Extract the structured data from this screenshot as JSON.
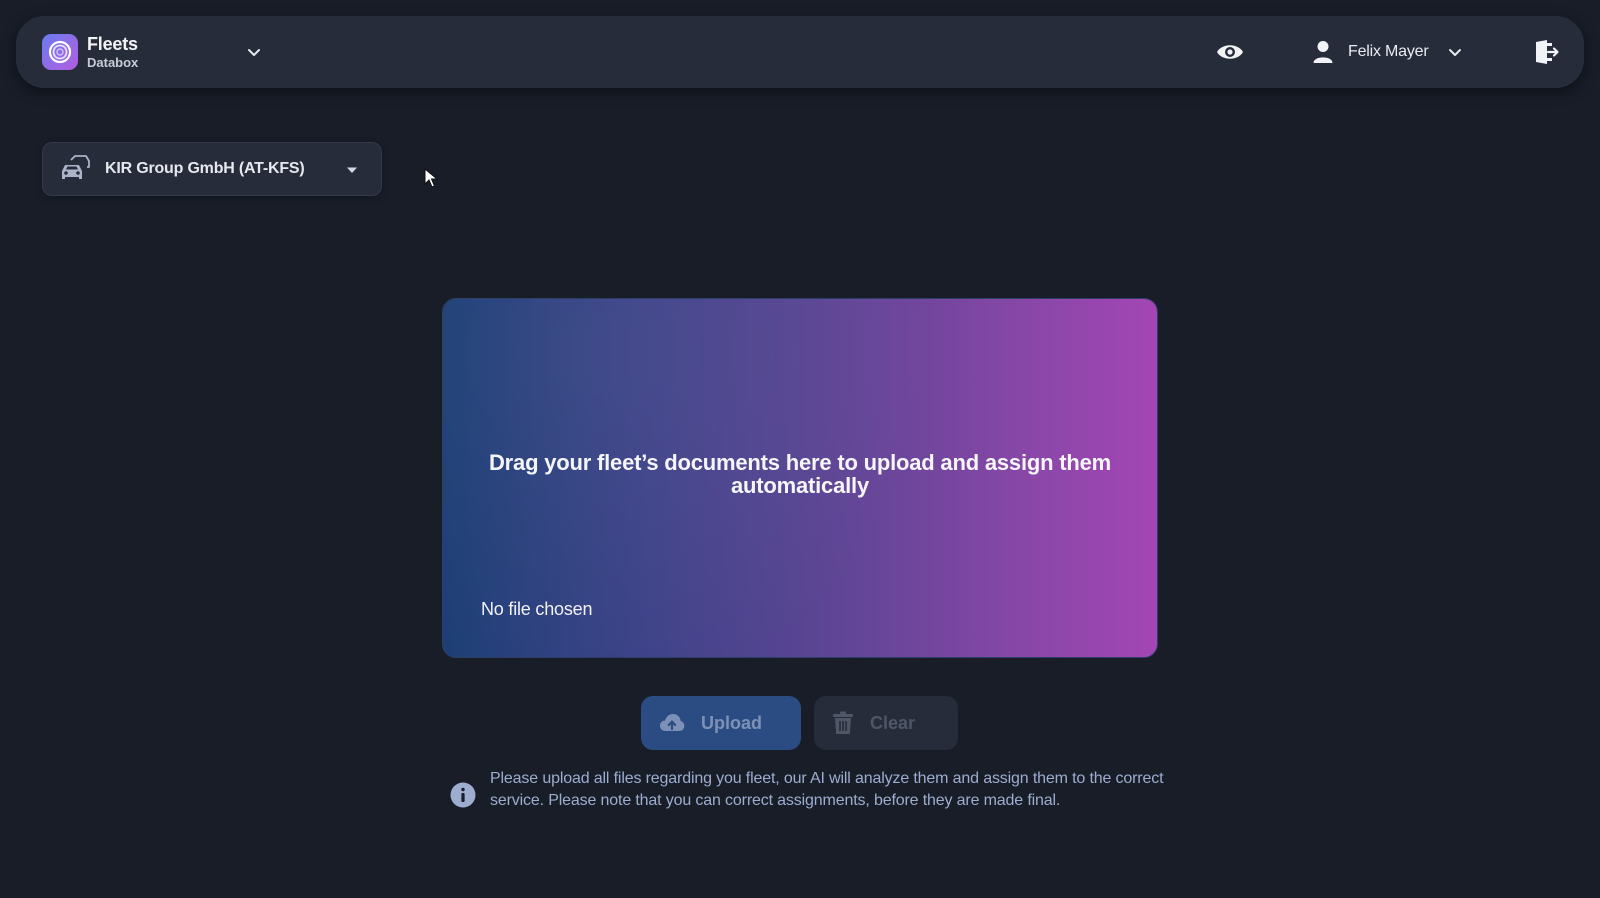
{
  "app": {
    "title": "Fleets",
    "subtitle": "Databox"
  },
  "header": {
    "user_name": "Felix Mayer",
    "icons": [
      "eye-icon",
      "user-icon",
      "chevron-down-icon",
      "logout-icon"
    ]
  },
  "organization": {
    "selected": "KIR Group GmbH (AT-KFS)",
    "icon": "fleet-cars-icon"
  },
  "dropzone": {
    "prompt": "Drag your fleet’s documents here to upload and assign them automatically",
    "file_status": "No file chosen"
  },
  "actions": {
    "upload_label": "Upload",
    "clear_label": "Clear"
  },
  "info": {
    "text": "Please upload all files regarding you fleet, our AI will analyze them and assign them to the correct service. Please note that you can correct assignments, before they are made final."
  },
  "colors": {
    "background": "#181d28",
    "surface": "#262c3a",
    "gradient_start": "#1c3e75",
    "gradient_end": "#a446b5",
    "upload_button": "#2b4c82",
    "info_text": "#9cadd0"
  }
}
